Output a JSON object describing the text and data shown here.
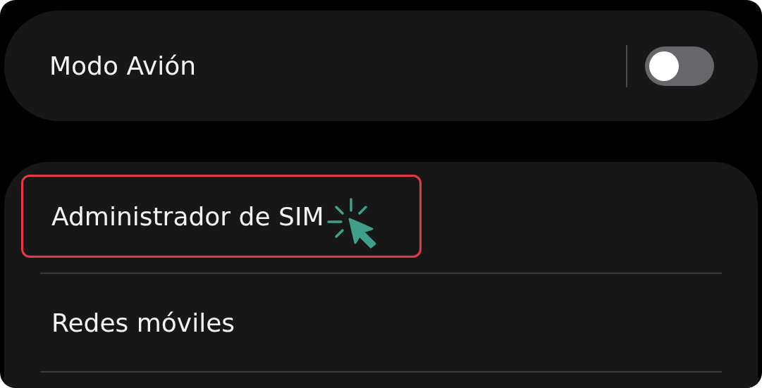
{
  "airplane_mode": {
    "label": "Modo Avión",
    "on": false
  },
  "items": [
    {
      "label": "Administrador de SIM",
      "highlighted": true
    },
    {
      "label": "Redes móviles",
      "highlighted": false
    }
  ]
}
